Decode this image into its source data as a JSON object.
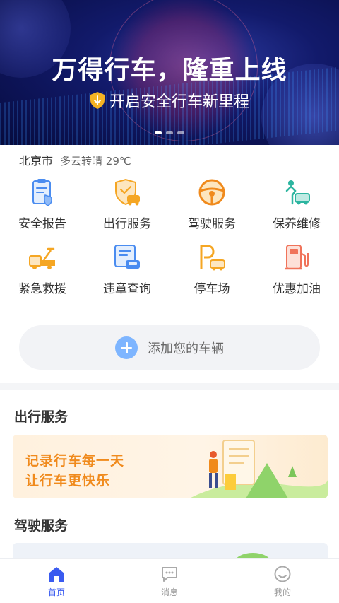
{
  "banner": {
    "title": "万得行车，隆重上线",
    "subtitle": "开启安全行车新里程",
    "page_count": 3,
    "active_page": 1
  },
  "weather": {
    "city": "北京市",
    "condition": "多云转晴 29℃"
  },
  "services": [
    {
      "label": "安全报告",
      "icon": "safety-report-icon",
      "color": "#4a8cf0"
    },
    {
      "label": "出行服务",
      "icon": "travel-service-icon",
      "color": "#f5a623"
    },
    {
      "label": "驾驶服务",
      "icon": "steering-wheel-icon",
      "color": "#f08a1c"
    },
    {
      "label": "保养维修",
      "icon": "maintenance-icon",
      "color": "#2cb5a0"
    },
    {
      "label": "紧急救援",
      "icon": "tow-truck-icon",
      "color": "#f5a623"
    },
    {
      "label": "违章查询",
      "icon": "violation-query-icon",
      "color": "#4a8cf0"
    },
    {
      "label": "停车场",
      "icon": "parking-icon",
      "color": "#f5a623"
    },
    {
      "label": "优惠加油",
      "icon": "fuel-pump-icon",
      "color": "#f0735a"
    }
  ],
  "add_vehicle": {
    "label": "添加您的车辆"
  },
  "travel_section": {
    "title": "出行服务",
    "card_line1": "记录行车每一天",
    "card_line2": "让行车更快乐"
  },
  "driving_section": {
    "title": "驾驶服务"
  },
  "bottom_nav": [
    {
      "label": "首页",
      "icon": "home-icon",
      "active": true
    },
    {
      "label": "消息",
      "icon": "message-icon",
      "active": false
    },
    {
      "label": "我的",
      "icon": "profile-icon",
      "active": false
    }
  ],
  "colors": {
    "accent": "#3a5bf0",
    "orange": "#f08a1c"
  }
}
